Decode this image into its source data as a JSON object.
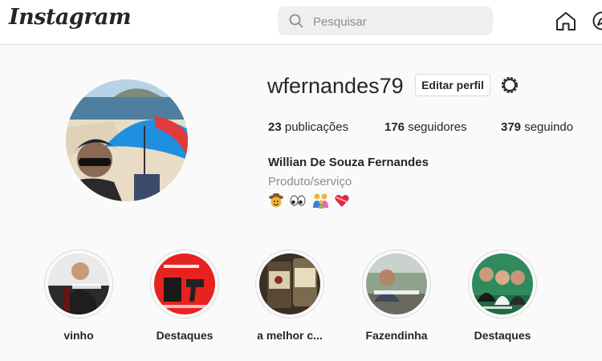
{
  "nav": {
    "logo_text": "Instagram",
    "search_placeholder": "Pesquisar",
    "search_value": "",
    "icons": [
      "search-icon",
      "home-icon",
      "explore-icon"
    ]
  },
  "profile": {
    "username": "wfernandes79",
    "edit_button_label": "Editar perfil",
    "settings_icon": "gear-icon",
    "stats": {
      "posts_count": "23",
      "posts_label": "publicações",
      "followers_count": "176",
      "followers_label": "seguidores",
      "following_count": "379",
      "following_label": "seguindo"
    },
    "full_name": "Willian De Souza Fernandes",
    "category": "Produto/serviço",
    "bio_emojis": [
      "cowboy-emoji",
      "eyes-emoji",
      "family-emoji",
      "heart-ribbon-emoji"
    ]
  },
  "highlights": [
    {
      "label": "vinho"
    },
    {
      "label": "Destaques"
    },
    {
      "label": "a melhor c..."
    },
    {
      "label": "Fazendinha"
    },
    {
      "label": "Destaques"
    }
  ],
  "colors": {
    "background": "#fafafa",
    "text": "#262626",
    "secondary_text": "#8e8e8e",
    "border": "#dbdbdb"
  }
}
